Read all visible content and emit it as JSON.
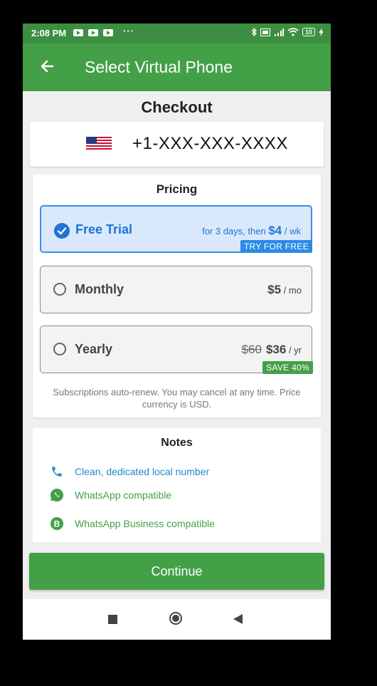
{
  "status_bar": {
    "time": "2:08 PM",
    "dots": "···",
    "battery": "10"
  },
  "app_bar": {
    "title": "Select Virtual Phone"
  },
  "checkout": {
    "heading": "Checkout",
    "phone_number": "+1-XXX-XXX-XXXX"
  },
  "pricing": {
    "title": "Pricing",
    "plans": [
      {
        "name": "Free Trial",
        "price_prefix": "for 3 days, then",
        "price": "$4",
        "unit": "/ wk",
        "badge": "TRY FOR FREE",
        "selected": true
      },
      {
        "name": "Monthly",
        "price": "$5",
        "unit": "/ mo",
        "selected": false
      },
      {
        "name": "Yearly",
        "old_price": "$60",
        "price": "$36",
        "unit": "/ yr",
        "badge": "SAVE 40%",
        "selected": false
      }
    ],
    "disclaimer": "Subscriptions auto-renew. You may cancel at any time. Price currency is USD."
  },
  "notes": {
    "title": "Notes",
    "items": [
      {
        "text": "Clean, dedicated local number",
        "icon": "phone-icon"
      },
      {
        "text": "WhatsApp compatible",
        "icon": "whatsapp-icon"
      },
      {
        "text": "WhatsApp Business compatible",
        "icon": "whatsapp-business-icon"
      }
    ]
  },
  "continue_label": "Continue",
  "colors": {
    "primary_green": "#43a047",
    "status_green": "#3c8f40",
    "selected_blue": "#1f74d4",
    "badge_blue": "#2b8be5"
  }
}
